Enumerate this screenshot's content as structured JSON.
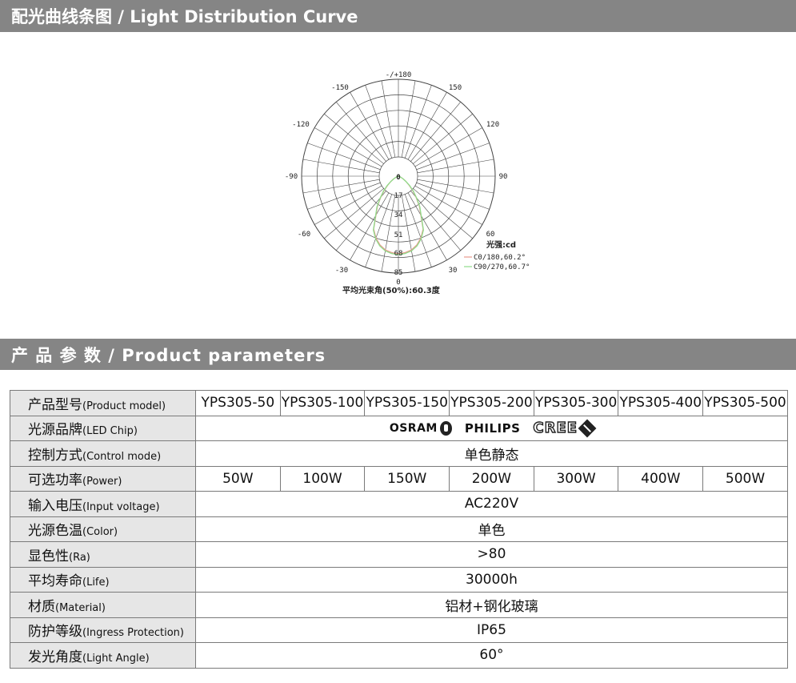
{
  "section1": {
    "title": "配光曲线条图 / Light Distribution Curve"
  },
  "section2": {
    "title": "产 品 参 数 / Product  parameters"
  },
  "polar": {
    "angle_labels": {
      "top": "-/+180",
      "n150": "-150",
      "p150": "150",
      "n120": "-120",
      "p120": "120",
      "n90": "-90",
      "p90": "90",
      "n60": "-60",
      "p60": "60",
      "n30": "-30",
      "p30": "30",
      "bottom": "0",
      "center": "0"
    },
    "radial_ticks": [
      "17",
      "34",
      "51",
      "68",
      "85"
    ],
    "unit_label": "光强:cd",
    "legend": [
      {
        "label": "C0/180,60.2°",
        "color": "#e89a8c"
      },
      {
        "label": "C90/270,60.7°",
        "color": "#8fdc8a"
      }
    ],
    "beam_note": "平均光束角(50%):60.3度",
    "max_cd": 85,
    "curves": {
      "c0": [
        [
          0,
          85
        ],
        [
          5,
          84
        ],
        [
          10,
          82
        ],
        [
          15,
          78
        ],
        [
          20,
          72
        ],
        [
          25,
          64
        ],
        [
          30,
          49
        ],
        [
          35,
          40
        ],
        [
          40,
          30
        ],
        [
          45,
          22
        ],
        [
          50,
          15
        ],
        [
          55,
          10
        ],
        [
          60,
          6
        ],
        [
          65,
          3
        ],
        [
          70,
          1
        ],
        [
          75,
          0
        ]
      ],
      "c90": [
        [
          0,
          86
        ],
        [
          5,
          85
        ],
        [
          10,
          83
        ],
        [
          15,
          79
        ],
        [
          20,
          73
        ],
        [
          25,
          65
        ],
        [
          30,
          50
        ],
        [
          35,
          41
        ],
        [
          40,
          31
        ],
        [
          45,
          23
        ],
        [
          50,
          16
        ],
        [
          55,
          10
        ],
        [
          60,
          6
        ],
        [
          65,
          3
        ],
        [
          70,
          1
        ],
        [
          75,
          0
        ]
      ]
    }
  },
  "params": {
    "rows": [
      {
        "cn": "产品型号",
        "en": "(Product model)",
        "type": "models",
        "values": [
          "YPS305-50",
          "YPS305-100",
          "YPS305-150",
          "YPS305-200",
          "YPS305-300",
          "YPS305-400",
          "YPS305-500"
        ]
      },
      {
        "cn": "光源品牌",
        "en": "(LED Chip)",
        "type": "brands",
        "brands": [
          "OSRAM",
          "PHILIPS",
          "CREE"
        ]
      },
      {
        "cn": "控制方式",
        "en": "(Control mode)",
        "type": "span",
        "value": "单色静态"
      },
      {
        "cn": "可选功率",
        "en": "(Power)",
        "type": "models",
        "values": [
          "50W",
          "100W",
          "150W",
          "200W",
          "300W",
          "400W",
          "500W"
        ]
      },
      {
        "cn": "输入电压",
        "en": "(Input voltage)",
        "type": "span",
        "value": "AC220V"
      },
      {
        "cn": "光源色温",
        "en": "(Color)",
        "type": "span",
        "value": "单色"
      },
      {
        "cn": "显色性",
        "en": "(Ra)",
        "type": "span",
        "value": ">80"
      },
      {
        "cn": "平均寿命",
        "en": "(Life)",
        "type": "span",
        "value": "30000h"
      },
      {
        "cn": "材质",
        "en": "(Material)",
        "type": "span",
        "value": "铝材+钢化玻璃"
      },
      {
        "cn": "防护等级",
        "en": "(Ingress Protection)",
        "type": "span",
        "value": "IP65"
      },
      {
        "cn": "发光角度",
        "en": "(Light Angle)",
        "type": "span",
        "value": "60°"
      }
    ]
  }
}
